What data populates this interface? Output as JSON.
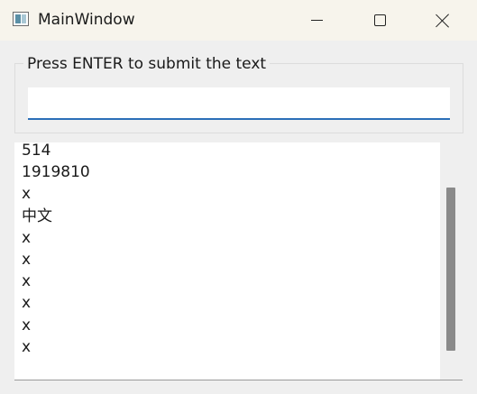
{
  "window": {
    "title": "MainWindow"
  },
  "input_group": {
    "title": "Press ENTER to submit the text",
    "input_value": ""
  },
  "list": {
    "items": [
      "514",
      "1919810",
      "x",
      "中文",
      "x",
      "x",
      "x",
      "x",
      "x",
      "x"
    ]
  },
  "colors": {
    "titlebar_bg": "#f7f4ec",
    "window_bg": "#efefef",
    "input_underline": "#2b6fb8",
    "scroll_thumb": "#8a8a8a"
  },
  "icons": {
    "app": "app-window-icon",
    "minimize": "minimize-icon",
    "maximize": "maximize-icon",
    "close": "close-icon"
  }
}
